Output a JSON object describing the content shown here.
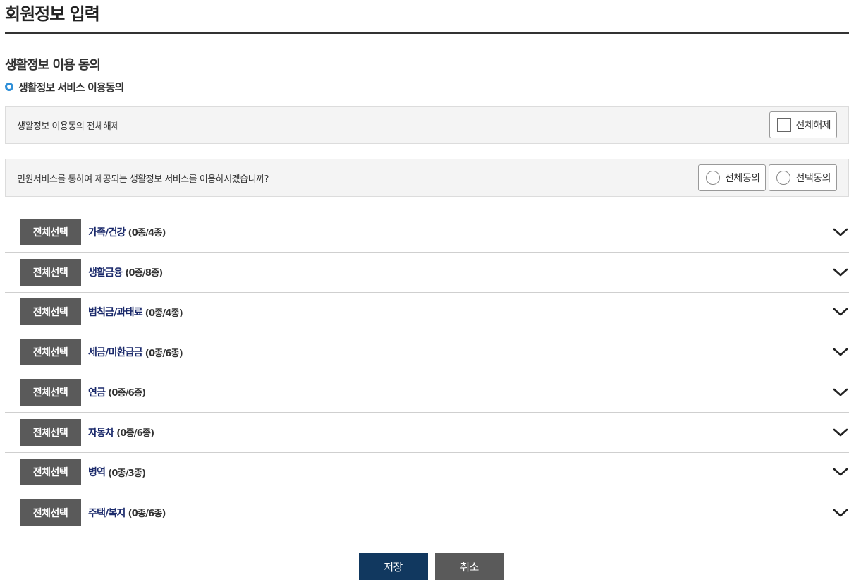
{
  "page": {
    "title": "회원정보 입력"
  },
  "section": {
    "title": "생활정보 이용 동의",
    "subtitle": "생활정보 서비스 이용동의"
  },
  "release_all": {
    "text": "생활정보 이용동의 전체해제",
    "button_label": "전체해제"
  },
  "consent": {
    "question": "민원서비스를 통하여 제공되는 생활정보 서비스를 이용하시겠습니까?",
    "agree_all_label": "전체동의",
    "agree_select_label": "선택동의"
  },
  "categories": [
    {
      "select_label": "전체선택",
      "name": "가족/건강",
      "count": "(0종/4종)"
    },
    {
      "select_label": "전체선택",
      "name": "생활금융",
      "count": "(0종/8종)"
    },
    {
      "select_label": "전체선택",
      "name": "범칙금/과태료",
      "count": "(0종/4종)"
    },
    {
      "select_label": "전체선택",
      "name": "세금/미환급금",
      "count": "(0종/6종)"
    },
    {
      "select_label": "전체선택",
      "name": "연금",
      "count": "(0종/6종)"
    },
    {
      "select_label": "전체선택",
      "name": "자동차",
      "count": "(0종/6종)"
    },
    {
      "select_label": "전체선택",
      "name": "병역",
      "count": "(0종/3종)"
    },
    {
      "select_label": "전체선택",
      "name": "주택/복지",
      "count": "(0종/6종)"
    }
  ],
  "actions": {
    "save_label": "저장",
    "cancel_label": "취소"
  },
  "colors": {
    "accent": "#2f8fd8",
    "save": "#11385f",
    "neutral": "#5a5a5a",
    "category_text": "#1b2a6b"
  }
}
